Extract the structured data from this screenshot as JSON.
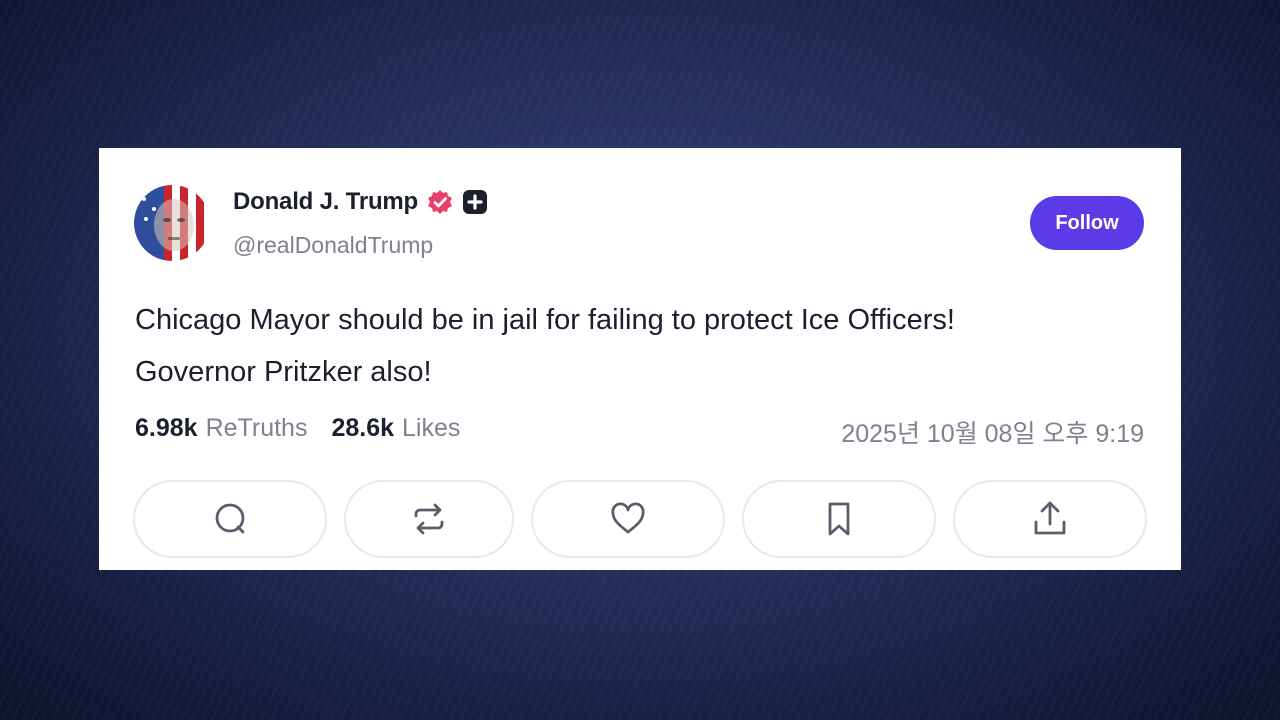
{
  "post": {
    "author": {
      "display_name": "Donald J. Trump",
      "handle": "@realDonaldTrump",
      "verified_badge_icon": "verified-badge-icon",
      "badge_color": "#e8406a",
      "extra_badge_icon": "plus-badge-icon"
    },
    "follow_label": "Follow",
    "text_lines": [
      "Chicago Mayor should be in jail for failing to protect Ice Officers!",
      "Governor Pritzker also!"
    ],
    "stats": {
      "retruths_count": "6.98k",
      "retruths_label": "ReTruths",
      "likes_count": "28.6k",
      "likes_label": "Likes"
    },
    "timestamp": "2025년 10월 08일 오후 9:19",
    "actions": [
      {
        "name": "reply",
        "icon": "reply-icon"
      },
      {
        "name": "retruth",
        "icon": "retruth-icon"
      },
      {
        "name": "like",
        "icon": "heart-icon"
      },
      {
        "name": "bookmark",
        "icon": "bookmark-icon"
      },
      {
        "name": "share",
        "icon": "share-icon"
      }
    ]
  },
  "colors": {
    "accent": "#5b3be8",
    "text_primary": "#1b1f2e",
    "text_secondary": "#7d8190",
    "card_background": "#ffffff",
    "page_background": "#26315f"
  }
}
